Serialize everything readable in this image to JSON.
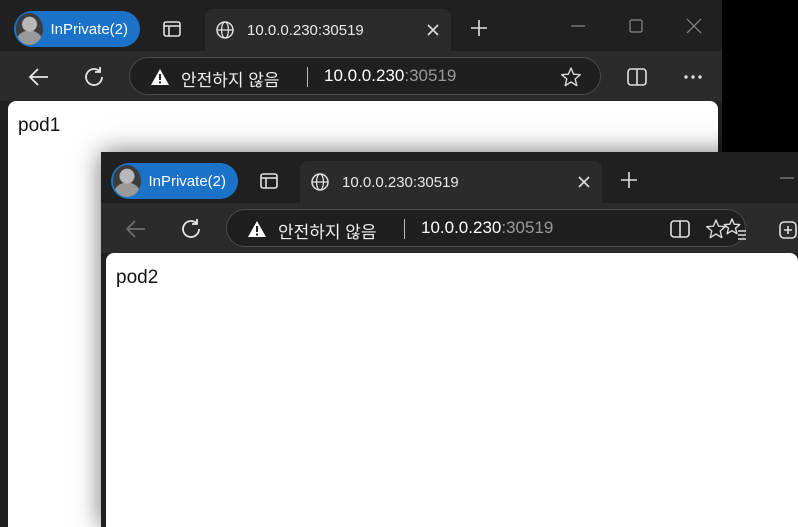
{
  "window1": {
    "profile_label": "InPrivate(2)",
    "tab_title": "10.0.0.230:30519",
    "security_warning": "안전하지 않음",
    "url_host": "10.0.0.230",
    "url_port": ":30519",
    "page_text": "pod1"
  },
  "window2": {
    "profile_label": "InPrivate(2)",
    "tab_title": "10.0.0.230:30519",
    "security_warning": "안전하지 않음",
    "url_host": "10.0.0.230",
    "url_port": ":30519",
    "page_text": "pod2"
  },
  "icons": [
    "profile-avatar",
    "tab-actions-icon",
    "globe-icon",
    "close-icon",
    "plus-icon",
    "minimize-icon",
    "maximize-icon",
    "back-arrow-icon",
    "refresh-icon",
    "warning-icon",
    "star-icon",
    "split-screen-icon",
    "more-icon",
    "favorites-icon",
    "collections-icon"
  ],
  "colors": {
    "titlebar": "#202020",
    "toolbar": "#2b2b2b",
    "inprivate_badge": "#1a73c8",
    "page_background": "#ffffff"
  }
}
